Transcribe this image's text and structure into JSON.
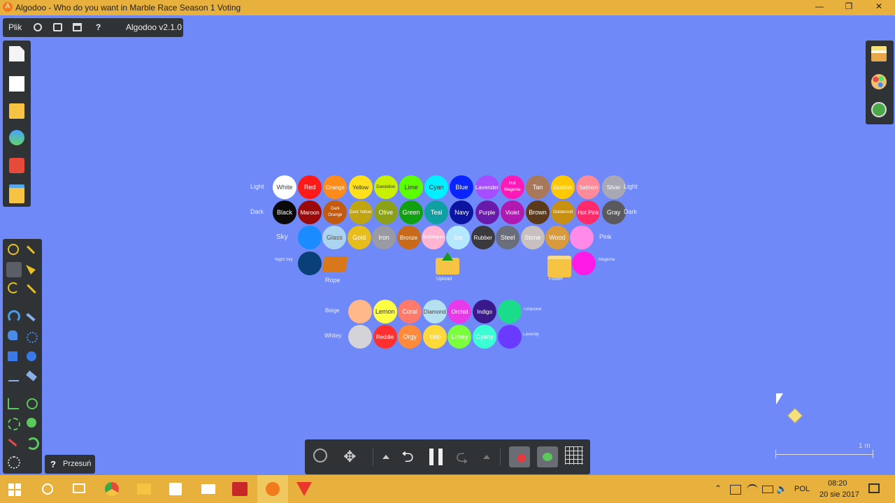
{
  "window": {
    "title": "Algodoo - Who do you want in Marble Race Season 1 Voting",
    "minimize": "—",
    "maximize": "❐",
    "close": "✕"
  },
  "topbar": {
    "menu": "Plik",
    "help": "?",
    "version": "Algodoo v2.1.0"
  },
  "tooltip": {
    "icon": "?",
    "label": "Przesuń"
  },
  "scale": {
    "label": "1 m"
  },
  "rows": {
    "light": [
      {
        "label": "White",
        "color": "#ffffff",
        "text": "#444"
      },
      {
        "label": "Red",
        "color": "#ff1a1a"
      },
      {
        "label": "Orange",
        "color": "#ff8c1a"
      },
      {
        "label": "Yellow",
        "color": "#ffe01a",
        "text": "#333"
      },
      {
        "label": "Dandelion",
        "color": "#c8f000",
        "text": "#333"
      },
      {
        "label": "Lime",
        "color": "#5cff00",
        "text": "#333"
      },
      {
        "label": "Cyan",
        "color": "#00f0ff",
        "text": "#333"
      },
      {
        "label": "Blue",
        "color": "#0a24ff"
      },
      {
        "label": "Lavender",
        "color": "#a64dff"
      },
      {
        "label": "Hot Magenta",
        "color": "#ff1ab8"
      },
      {
        "label": "Tan",
        "color": "#a8785a"
      },
      {
        "label": "Goldish",
        "color": "#ffc800"
      },
      {
        "label": "Salmon",
        "color": "#ff8a9a"
      },
      {
        "label": "Silver",
        "color": "#a8a8b4"
      }
    ],
    "dark": [
      {
        "label": "Black",
        "color": "#0a0a0a"
      },
      {
        "label": "Maroon",
        "color": "#9a0a0a"
      },
      {
        "label": "Dark Orange",
        "color": "#c25a10"
      },
      {
        "label": "Dark Yellow",
        "color": "#c0a410"
      },
      {
        "label": "Olive",
        "color": "#8ca018"
      },
      {
        "label": "Green",
        "color": "#10a010"
      },
      {
        "label": "Teal",
        "color": "#10a0a4"
      },
      {
        "label": "Navy",
        "color": "#0a14a0"
      },
      {
        "label": "Purple",
        "color": "#6a1aa8"
      },
      {
        "label": "Violet",
        "color": "#b01ab0"
      },
      {
        "label": "Brown",
        "color": "#5a3a1a"
      },
      {
        "label": "Goldenrod",
        "color": "#c89010"
      },
      {
        "label": "Hot Pink",
        "color": "#ff2a6a"
      },
      {
        "label": "Gray",
        "color": "#5a5a5e"
      }
    ],
    "sky": [
      {
        "label": "",
        "color": "#1a8cff"
      },
      {
        "label": "Glass",
        "color": "#aad4f0",
        "text": "#555"
      },
      {
        "label": "Gold",
        "color": "#e8bc1a"
      },
      {
        "label": "Iron",
        "color": "#9a9aa4"
      },
      {
        "label": "Bronze",
        "color": "#c86a1a"
      },
      {
        "label": "Bubblegum",
        "color": "#ffb4d4"
      },
      {
        "label": "Ice",
        "color": "#b4e8ff"
      },
      {
        "label": "Rubber",
        "color": "#3a3a3e"
      },
      {
        "label": "Steel",
        "color": "#6a6e7a"
      },
      {
        "label": "Stone",
        "color": "#c8c0c0"
      },
      {
        "label": "Wood",
        "color": "#d89a3a"
      },
      {
        "label": "",
        "color": "#ff8ae8"
      }
    ],
    "night": [
      {
        "label": "",
        "color": "#0a4078"
      }
    ],
    "beige": [
      {
        "label": "",
        "color": "#ffb88a"
      },
      {
        "label": "Lemon",
        "color": "#ffff44",
        "text": "#333"
      },
      {
        "label": "Coral",
        "color": "#ff7a6a"
      },
      {
        "label": "Diamond",
        "color": "#b4e0f0",
        "text": "#444"
      },
      {
        "label": "Orchid",
        "color": "#e83ae8"
      },
      {
        "label": "Indigo",
        "color": "#3a1a8a"
      },
      {
        "label": "",
        "color": "#1adc8a"
      }
    ],
    "whitey": [
      {
        "label": "",
        "color": "#d4d4d8"
      },
      {
        "label": "Reddie",
        "color": "#ff3030"
      },
      {
        "label": "Orgy",
        "color": "#ff8a3a"
      },
      {
        "label": "Yelo",
        "color": "#ffd83a"
      },
      {
        "label": "Limey",
        "color": "#7aff3a"
      },
      {
        "label": "Cyany",
        "color": "#3affd4"
      },
      {
        "label": "",
        "color": "#6a3aff"
      }
    ]
  },
  "side_labels": {
    "light_left": "Light",
    "light_right": "Light",
    "dark_left": "Dark",
    "dark_right": "Dark",
    "sky": "Sky",
    "pink": "Pink",
    "night_sky": "Night Sky",
    "magenta": "Magenta",
    "rope": "Rope",
    "upload": "Upload",
    "folder": "Folder",
    "beige": "Beige",
    "whitey": "Whitey",
    "turquoise": "Turquoise",
    "lavendy": "Lavendy"
  },
  "taskbar": {
    "lang": "POL",
    "time": "08:20",
    "date": "20 sie 2017"
  }
}
